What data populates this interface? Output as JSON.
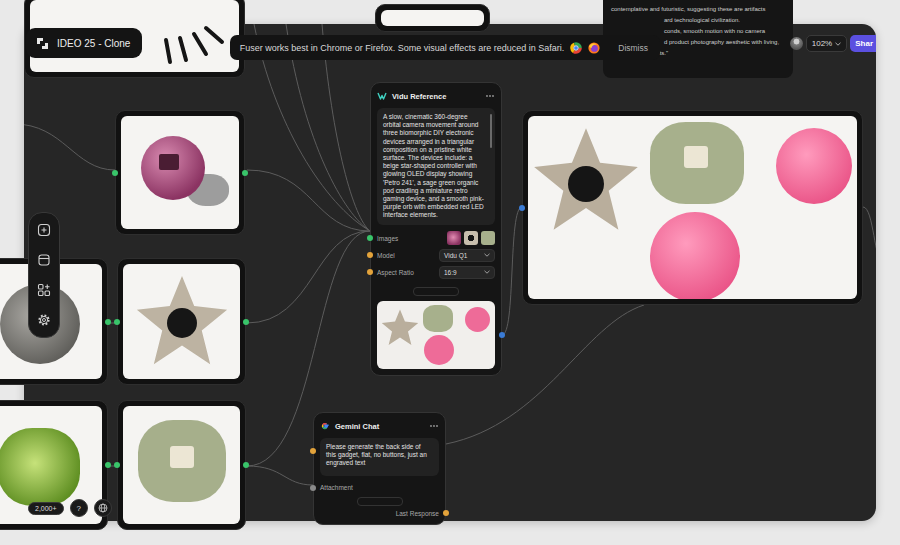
{
  "project": {
    "title": "IDEO 25 - Clone"
  },
  "banner": {
    "message": "Fuser works best in Chrome or Firefox. Some visual effects are reduced in Safari.",
    "dismiss": "Dismiss"
  },
  "tooltip": {
    "lines": [
      {
        "text": "contemplative and futuristic, suggesting these are artifacts",
        "cut": false
      },
      {
        "text": "ard technological civilization.",
        "cut": true
      },
      {
        "text": "conds, smooth motion with no camera",
        "cut": true
      },
      {
        "text": "d product photography aesthetic with living,",
        "cut": true
      },
      {
        "text": "interactive elements.\"",
        "cut": false
      }
    ]
  },
  "topbar": {
    "zoom": "102%",
    "share": "Shar"
  },
  "vidu_node": {
    "title": "Vidu Reference",
    "prompt": "A slow, cinematic 360-degree orbital camera movement around three biomorphic DIY electronic devices arranged in a triangular composition on a pristine white surface. The devices include: a beige star-shaped controller with glowing OLED display showing 'Petro 241', a sage green organic pod cradling a miniature retro gaming device, and a smooth pink-purple orb with embedded red LED interface elements.",
    "fields": [
      {
        "label": "Images",
        "kind": "images"
      },
      {
        "label": "Model",
        "kind": "select",
        "value": "Vidu Q1"
      },
      {
        "label": "Aspect Ratio",
        "kind": "select",
        "value": "16:9"
      }
    ]
  },
  "gemini_node": {
    "title": "Gemini Chat",
    "prompt": "Please generate the back side of this gadget, flat, no buttons, just an engraved text",
    "fields": [
      {
        "label": "Attachment",
        "kind": "input"
      }
    ],
    "output": "Last Response"
  },
  "footer": {
    "credits": "2,000+",
    "help": "?"
  }
}
